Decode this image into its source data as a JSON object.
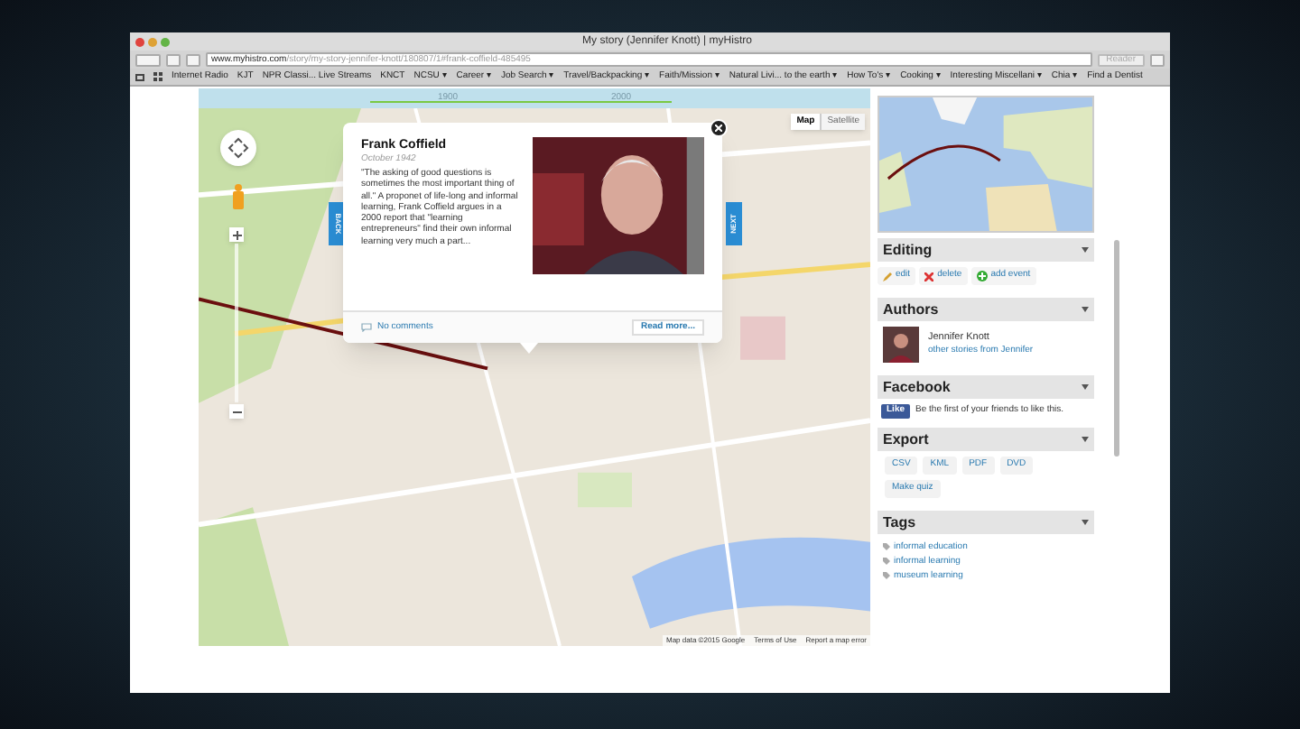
{
  "window": {
    "title": "My story (Jennifer Knott) | myHistro"
  },
  "toolbar": {
    "url_host": "www.myhistro.com",
    "url_path": "/story/my-story-jennifer-knott/180807/1#frank-coffield-485495",
    "reader": "Reader"
  },
  "bookmarks": [
    "Internet Radio",
    "KJT",
    "NPR Classi... Live Streams",
    "KNCT",
    "NCSU ▾",
    "Career ▾",
    "Job Search ▾",
    "Travel/Backpacking ▾",
    "Faith/Mission ▾",
    "Natural Livi... to the earth ▾",
    "How To's ▾",
    "Cooking ▾",
    "Interesting Miscellani ▾",
    "Chia ▾",
    "Find a Dentist"
  ],
  "timeline": {
    "labels": [
      "1900",
      "2000"
    ]
  },
  "map": {
    "types": [
      {
        "label": "Map",
        "selected": true
      },
      {
        "label": "Satellite",
        "selected": false
      }
    ],
    "back": "BACK",
    "next": "NEXT",
    "attribution": [
      "Map data ©2015 Google",
      "Terms of Use",
      "Report a map error"
    ]
  },
  "popup": {
    "title": "Frank Coffield",
    "date": "October 1942",
    "text": "\"The asking of good questions is sometimes the most important thing of all.\" A proponet of life-long and informal learning, Frank Coffield argues in a 2000 report that \"learning entrepreneurs\" find their own informal learning very much a part...",
    "comments": "No comments",
    "read_more": "Read more..."
  },
  "sidebar": {
    "editing": {
      "title": "Editing",
      "actions": [
        {
          "label": "edit",
          "kind": "edit"
        },
        {
          "label": "delete",
          "kind": "delete"
        },
        {
          "label": "add event",
          "kind": "add"
        }
      ]
    },
    "authors": {
      "title": "Authors",
      "name": "Jennifer Knott",
      "link": "other stories from Jennifer"
    },
    "facebook": {
      "title": "Facebook",
      "like": "Like",
      "text": "Be the first of your friends to like this."
    },
    "export": {
      "title": "Export",
      "buttons": [
        "CSV",
        "KML",
        "PDF",
        "DVD",
        "Make quiz"
      ]
    },
    "tags": {
      "title": "Tags",
      "items": [
        "informal education",
        "informal learning",
        "museum learning"
      ]
    }
  }
}
